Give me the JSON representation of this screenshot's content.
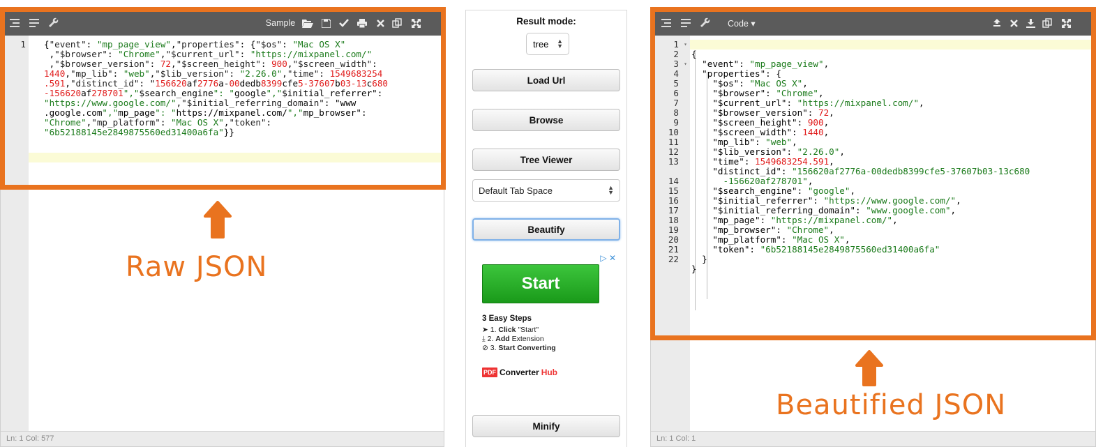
{
  "left_panel": {
    "toolbar": {
      "sample_label": "Sample"
    },
    "code_lines": [
      "{\"event\": \"mp_page_view\",\"properties\": {\"$os\": \"Mac OS X\"",
      " ,\"$browser\": \"Chrome\",\"$current_url\": \"https://mixpanel.com/\"",
      " ,\"$browser_version\": 72,\"$screen_height\": 900,\"$screen_width\":",
      "1440,\"mp_lib\": \"web\",\"$lib_version\": \"2.26.0\",\"time\": 1549683254",
      ".591,\"distinct_id\": \"156620af2776a-00dedb8399cfe5-37607b03-13c680",
      "-156620af278701\",\"$search_engine\": \"google\",\"$initial_referrer\":",
      "\"https://www.google.com/\",\"$initial_referring_domain\": \"www",
      ".google.com\",\"mp_page\": \"https://mixpanel.com/\",\"mp_browser\":",
      "\"Chrome\",\"mp_platform\": \"Mac OS X\",\"token\":",
      "\"6b52188145e2849875560ed31400a6fa\"}}"
    ],
    "line_number": "1",
    "status": "Ln: 1    Col: 577"
  },
  "middle": {
    "result_mode_label": "Result mode:",
    "result_mode_value": "tree",
    "load_url_label": "Load Url",
    "browse_label": "Browse",
    "tree_viewer_label": "Tree Viewer",
    "tab_space_value": "Default Tab Space",
    "beautify_label": "Beautify",
    "minify_label": "Minify",
    "ad": {
      "choice": "▷ ✕",
      "start_label": "Start",
      "title": "3 Easy Steps",
      "steps": [
        {
          "num": "1.",
          "bold": "Click",
          "rest": " \"Start\""
        },
        {
          "num": "2.",
          "bold": "Add",
          "rest": " Extension"
        },
        {
          "num": "3.",
          "bold": "Start Converting",
          "rest": ""
        }
      ],
      "logo_badge": "PDF",
      "logo_name": "Converter",
      "logo_name2": "Hub"
    }
  },
  "right_panel": {
    "toolbar": {
      "code_label": "Code ▾"
    },
    "line_numbers": [
      "1",
      "2",
      "3",
      "4",
      "5",
      "6",
      "7",
      "8",
      "9",
      "10",
      "11",
      "12",
      "13",
      "",
      "14",
      "15",
      "16",
      "17",
      "18",
      "19",
      "20",
      "21",
      "22"
    ],
    "status": "Ln: 1    Col: 1"
  },
  "annotations": {
    "raw_label": "Raw JSON",
    "beautified_label": "Beautified JSON",
    "accent_color": "#e9731f"
  },
  "colors": {
    "toolbar_bg": "#5b5b5b",
    "string": "#1a7a1a",
    "number": "#e01a1a"
  }
}
